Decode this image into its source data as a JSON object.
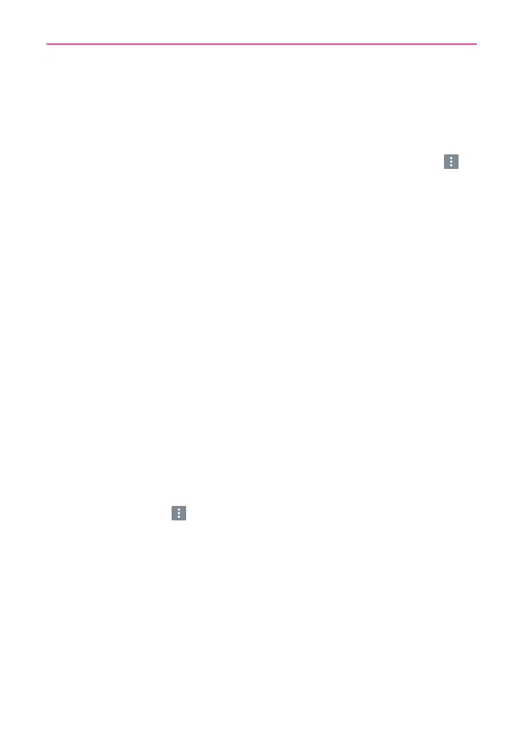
{
  "page": {
    "accent_color": "#c3145a",
    "icons": [
      {
        "name": "more-options-icon",
        "color": "#7f8a93"
      },
      {
        "name": "more-options-icon",
        "color": "#7f8a93"
      }
    ]
  }
}
